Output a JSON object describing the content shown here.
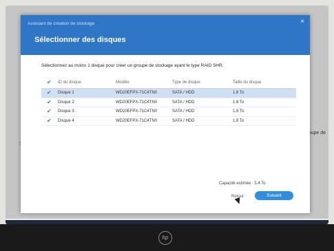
{
  "dialog": {
    "wizard_title": "Assistant de création de stockage",
    "title": "Sélectionner des disques",
    "instruction": "Sélectionnez au moins 1 disque pour créer un groupe de stockage ayant le type RAID SHR.",
    "columns": {
      "id": "ID du disque",
      "model": "Modèle",
      "type": "Type de disque",
      "size": "Taille du disque"
    },
    "disks": [
      {
        "id": "Disque 1",
        "model": "WD20EFPX-71C4TN0",
        "type": "SATA / HDD",
        "size": "1.8 To",
        "selected": true
      },
      {
        "id": "Disque 2",
        "model": "WD20EFPX-71C4TN0",
        "type": "SATA / HDD",
        "size": "1.8 To",
        "selected": false
      },
      {
        "id": "Disque 3",
        "model": "WD20EFPX-71C4TN0",
        "type": "SATA / HDD",
        "size": "1.8 To",
        "selected": false
      },
      {
        "id": "Disque 4",
        "model": "WD20EFPX-71C4TN0",
        "type": "SATA / HDD",
        "size": "1.8 To",
        "selected": false
      }
    ],
    "capacity": "Capacité estimée : 5.4 To",
    "back_label": "Retour",
    "next_label": "Suivant",
    "close_symbol": "×"
  },
  "background": {
    "right_text": "un groupe de",
    "left_text": "Su"
  },
  "brand": {
    "logo_text": "hp",
    "accent": "#2f76c6",
    "button_color": "#2f8fdf"
  }
}
